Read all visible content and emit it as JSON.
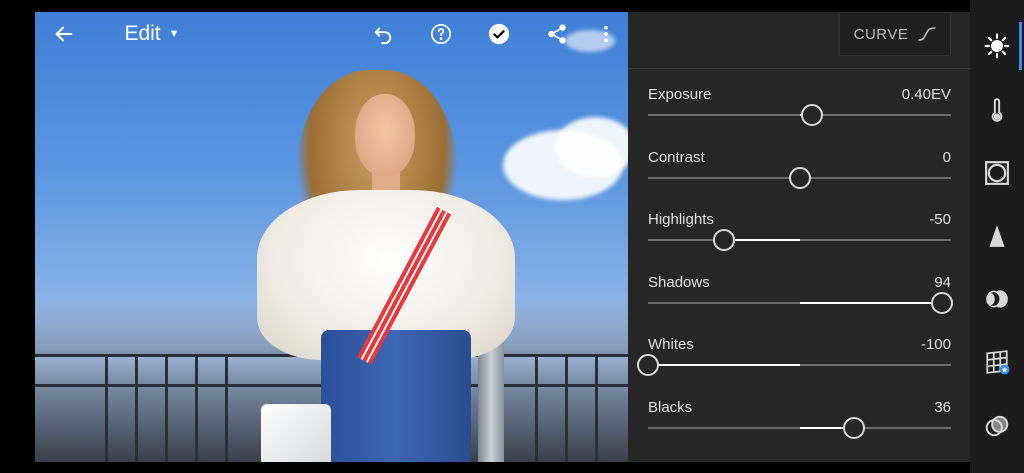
{
  "toolbar": {
    "back_icon": "arrow-left-icon",
    "title": "Edit",
    "items": [
      "undo-icon",
      "help-icon",
      "done-check-icon",
      "share-icon",
      "more-vertical-icon"
    ]
  },
  "panel": {
    "curve_button": "CURVE",
    "sliders": [
      {
        "label": "Exposure",
        "value": "0.40EV",
        "position": 0.54
      },
      {
        "label": "Contrast",
        "value": "0",
        "position": 0.5
      },
      {
        "label": "Highlights",
        "value": "-50",
        "position": 0.25
      },
      {
        "label": "Shadows",
        "value": "94",
        "position": 0.97
      },
      {
        "label": "Whites",
        "value": "-100",
        "position": 0.0
      },
      {
        "label": "Blacks",
        "value": "36",
        "position": 0.68
      }
    ]
  },
  "rail": {
    "icons": [
      "light-sun-icon",
      "color-thermometer-icon",
      "effects-vignette-icon",
      "detail-triangle-icon",
      "optics-lens-icon",
      "geometry-grid-icon",
      "presets-overlap-icon"
    ],
    "active": "light-sun-icon",
    "accent_color": "#3b8ef0"
  }
}
